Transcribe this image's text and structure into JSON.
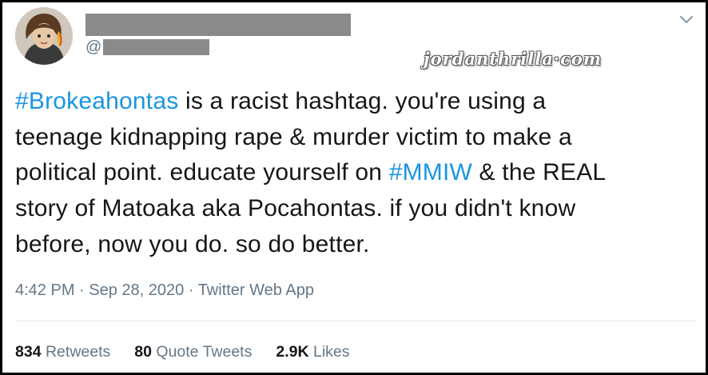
{
  "tweet": {
    "handle_prefix": "@",
    "watermark": "jordanthrilla·com",
    "lines": [
      {
        "segments": [
          {
            "text": "#Brokeahontas",
            "hashtag": true
          },
          {
            "text": " is a racist hashtag. you're using a",
            "hashtag": false
          }
        ]
      },
      {
        "segments": [
          {
            "text": "teenage kidnapping rape & murder victim to make a",
            "hashtag": false
          }
        ]
      },
      {
        "segments": [
          {
            "text": "political point. educate yourself on ",
            "hashtag": false
          },
          {
            "text": "#MMIW",
            "hashtag": true
          },
          {
            "text": " & the REAL",
            "hashtag": false
          }
        ]
      },
      {
        "segments": [
          {
            "text": "story of Matoaka aka Pocahontas. if you didn't know",
            "hashtag": false
          }
        ]
      },
      {
        "segments": [
          {
            "text": "before, now you do. so do better.",
            "hashtag": false
          }
        ]
      }
    ],
    "time": "4:42 PM",
    "date": "Sep 28, 2020",
    "source": "Twitter Web App",
    "separator": " · ",
    "retweets_count": "834",
    "retweets_label": "Retweets",
    "quote_count": "80",
    "quote_label": "Quote Tweets",
    "likes_count": "2.9K",
    "likes_label": "Likes"
  },
  "icons": {
    "caret": "chevron-down-icon"
  },
  "colors": {
    "text": "#14171a",
    "secondary": "#657786",
    "hashtag": "#1b95e0",
    "redaction": "#8a8a8a",
    "frame": "#000000"
  }
}
